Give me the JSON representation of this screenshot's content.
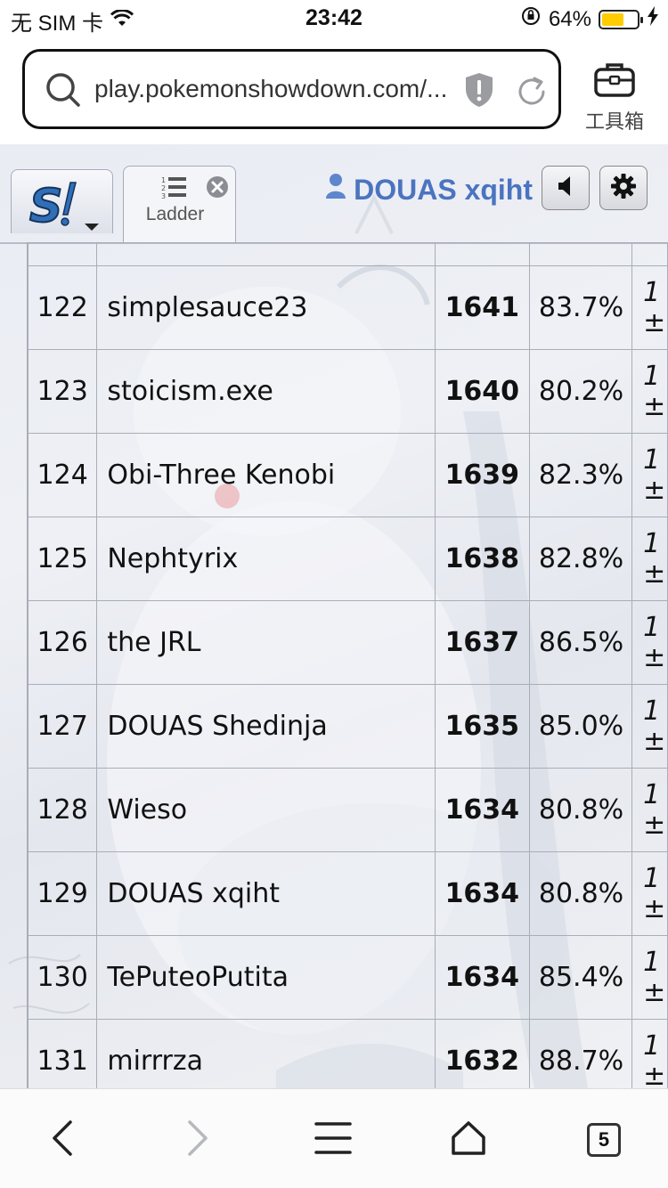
{
  "status_bar": {
    "carrier": "无 SIM 卡",
    "time": "23:42",
    "battery_percent": "64%",
    "battery_level": 0.64,
    "battery_color": "#ffcc00"
  },
  "browser": {
    "url": "play.pokemonshowdown.com/...",
    "toolbox_label": "工具箱",
    "tab_count": "5"
  },
  "app": {
    "ladder_tab_label": "Ladder",
    "username": "DOUAS xqiht",
    "username_color": "#4b74c0"
  },
  "ladder": {
    "rows": [
      {
        "rank": "122",
        "name": "simplesauce23",
        "elo": "1641",
        "gxe": "83.7%",
        "glicko_a": "1",
        "glicko_b": "±"
      },
      {
        "rank": "123",
        "name": "stoicism.exe",
        "elo": "1640",
        "gxe": "80.2%",
        "glicko_a": "1",
        "glicko_b": "±"
      },
      {
        "rank": "124",
        "name": "Obi-Three Kenobi",
        "elo": "1639",
        "gxe": "82.3%",
        "glicko_a": "1",
        "glicko_b": "±"
      },
      {
        "rank": "125",
        "name": "Nephtyrix",
        "elo": "1638",
        "gxe": "82.8%",
        "glicko_a": "1",
        "glicko_b": "±"
      },
      {
        "rank": "126",
        "name": "the JRL",
        "elo": "1637",
        "gxe": "86.5%",
        "glicko_a": "1",
        "glicko_b": "±"
      },
      {
        "rank": "127",
        "name": "DOUAS Shedinja",
        "elo": "1635",
        "gxe": "85.0%",
        "glicko_a": "1",
        "glicko_b": "±"
      },
      {
        "rank": "128",
        "name": "Wieso",
        "elo": "1634",
        "gxe": "80.8%",
        "glicko_a": "1",
        "glicko_b": "±"
      },
      {
        "rank": "129",
        "name": "DOUAS xqiht",
        "elo": "1634",
        "gxe": "80.8%",
        "glicko_a": "1",
        "glicko_b": "±"
      },
      {
        "rank": "130",
        "name": "TePuteoPutita",
        "elo": "1634",
        "gxe": "85.4%",
        "glicko_a": "1",
        "glicko_b": "±"
      },
      {
        "rank": "131",
        "name": "mirrrza",
        "elo": "1632",
        "gxe": "88.7%",
        "glicko_a": "1",
        "glicko_b": "±"
      }
    ]
  }
}
